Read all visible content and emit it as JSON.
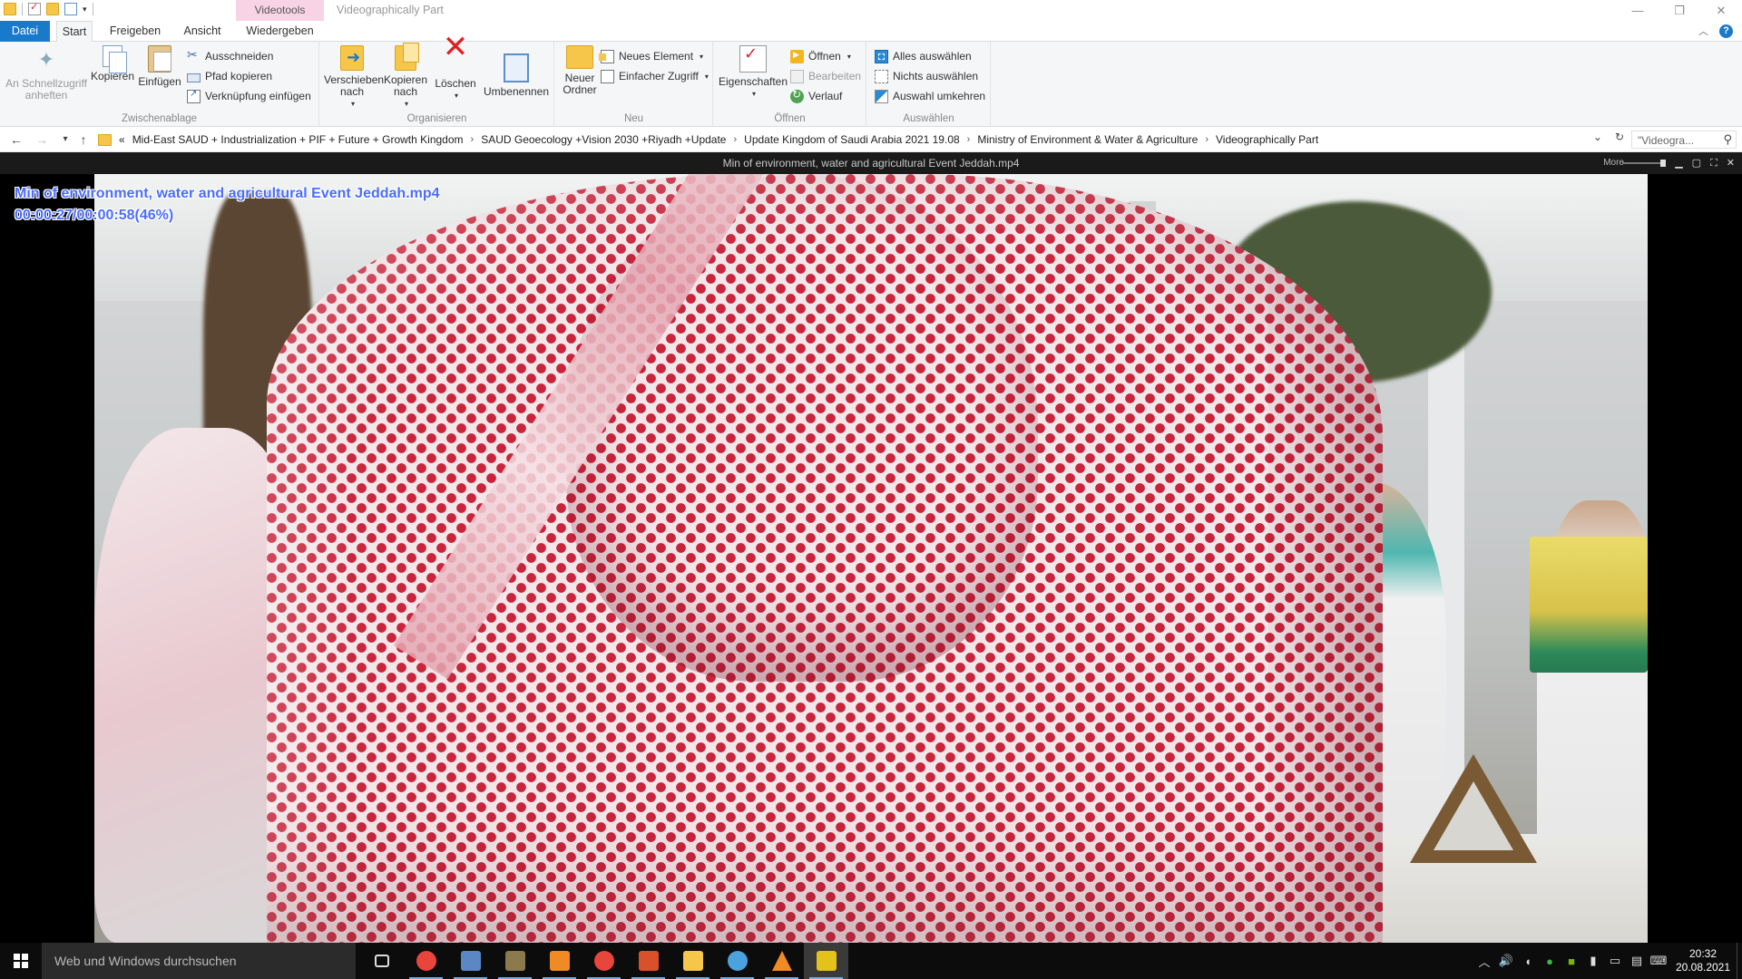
{
  "titlebar": {
    "context_tab_header": "Videotools",
    "window_title": "Videographically Part",
    "minimize_glyph": "—",
    "maximize_glyph": "❐",
    "close_glyph": "✕"
  },
  "tabs": {
    "file": "Datei",
    "start": "Start",
    "share": "Freigeben",
    "view": "Ansicht",
    "play": "Wiedergeben"
  },
  "ribbon": {
    "clipboard": {
      "label": "Zwischenablage",
      "pin": "An Schnellzugriff anheften",
      "copy": "Kopieren",
      "paste": "Einfügen",
      "cut": "Ausschneiden",
      "copy_path": "Pfad kopieren",
      "paste_shortcut": "Verknüpfung einfügen"
    },
    "organize": {
      "label": "Organisieren",
      "move_to": "Verschieben nach",
      "copy_to": "Kopieren nach",
      "delete": "Löschen",
      "rename": "Umbenennen"
    },
    "new": {
      "label": "Neu",
      "new_folder": "Neuer Ordner",
      "new_item": "Neues Element",
      "easy_access": "Einfacher Zugriff"
    },
    "open": {
      "label": "Öffnen",
      "properties": "Eigenschaften",
      "open": "Öffnen",
      "edit": "Bearbeiten",
      "history": "Verlauf"
    },
    "select": {
      "label": "Auswählen",
      "select_all": "Alles auswählen",
      "select_none": "Nichts auswählen",
      "invert": "Auswahl umkehren"
    }
  },
  "address": {
    "overflow": "«",
    "crumbs": [
      "Mid-East SAUD + Industrialization + PIF + Future + Growth Kingdom",
      "SAUD Geoecology +Vision 2030 +Riyadh +Update",
      "Update Kingdom of Saudi Arabia 2021 19.08",
      "Ministry of Environment &  Water & Agriculture",
      "Videographically Part"
    ],
    "search_placeholder": "\"Videogra..."
  },
  "player": {
    "title": "Min of environment, water and agricultural Event Jeddah.mp4",
    "more_label": "More",
    "osd_filename": "Min of environment, water and agricultural Event Jeddah.mp4",
    "osd_time": "00:00:27/00:00:58(46%)",
    "progress_fraction": 0.46
  },
  "taskbar": {
    "search_placeholder": "Web und Windows durchsuchen",
    "apps": [
      {
        "name": "task-view-icon",
        "color": "#0c0c0c"
      },
      {
        "name": "chrome-icon",
        "color": "#e8453c"
      },
      {
        "name": "picture-viewer-icon",
        "color": "#5b87c5"
      },
      {
        "name": "photo-app-icon",
        "color": "#8a7a4c"
      },
      {
        "name": "media-app-icon",
        "color": "#f08a24"
      },
      {
        "name": "browser-icon",
        "color": "#e8453c"
      },
      {
        "name": "document-app-icon",
        "color": "#d8512b"
      },
      {
        "name": "file-explorer-icon",
        "color": "#f6c64b"
      },
      {
        "name": "photo-editor-icon",
        "color": "#4aa3df"
      },
      {
        "name": "vlc-icon",
        "color": "#f08a24"
      },
      {
        "name": "video-player-icon",
        "color": "#e3c21c"
      }
    ],
    "time": "20:32",
    "date": "20.08.2021"
  },
  "colors": {
    "accent": "#1979ca",
    "osd_text": "#4a6cff",
    "context_tab": "#f8d3e6"
  }
}
